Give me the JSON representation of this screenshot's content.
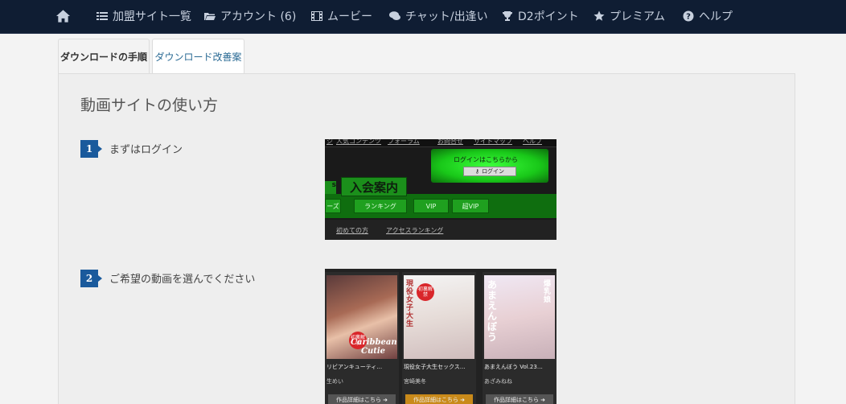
{
  "nav": {
    "items": [
      {
        "label": "加盟サイト一覧",
        "icon": "list-icon"
      },
      {
        "label": "アカウント (6)",
        "icon": "folder-icon"
      },
      {
        "label": "ムービー",
        "icon": "film-icon"
      },
      {
        "label": "チャット/出逢い",
        "icon": "chat-icon"
      },
      {
        "label": "D2ポイント",
        "icon": "trophy-icon"
      },
      {
        "label": "プレミアム",
        "icon": "star-icon"
      },
      {
        "label": "ヘルプ",
        "icon": "question-icon"
      }
    ],
    "home_icon": "home-icon"
  },
  "tabs": [
    {
      "label": "ダウンロードの手順",
      "active": true
    },
    {
      "label": "ダウンロード改善案",
      "active": false
    }
  ],
  "panel": {
    "title": "動画サイトの使い方",
    "steps": [
      {
        "number": "1",
        "label": "まずはログイン"
      },
      {
        "number": "2",
        "label": "ご希望の動画を選んでください"
      }
    ]
  },
  "shot1": {
    "top_links": [
      "ジ",
      "人気コンテンツ",
      "フォーラム",
      "お問合せ",
      "サイトマップ",
      "ヘルプ"
    ],
    "login_prompt": "ログインはこちらから",
    "login_button": "ログイン",
    "join_label": "入会案内",
    "s_left": "s",
    "menu": [
      "ーズ",
      "ランキング",
      "VIP",
      "超VIP"
    ],
    "bottom_links": [
      "初めての方",
      "アクセスランキング"
    ]
  },
  "shot2": {
    "cards": [
      {
        "title": "リビアンキューティ…",
        "name": "生めい",
        "button": "作品詳細はこちら ➜",
        "overlay": "Caribbean Cutie",
        "badge": "初裏解禁"
      },
      {
        "title": "現役女子大生セックス…",
        "name": "宮崎美冬",
        "button": "作品詳細はこちら ➜",
        "overlay": "現役女子大生",
        "badge": "初裏解禁"
      },
      {
        "title": "あまえんぼう Vol.23…",
        "name": "あざみねね",
        "button": "作品詳細はこちら ➜",
        "overlay": "あまえんぼう",
        "badge": "爆乳娘"
      }
    ]
  },
  "colors": {
    "nav_bg": "#0f1d33",
    "badge_blue": "#1a5a9c",
    "tab_link": "#2a6a94"
  }
}
